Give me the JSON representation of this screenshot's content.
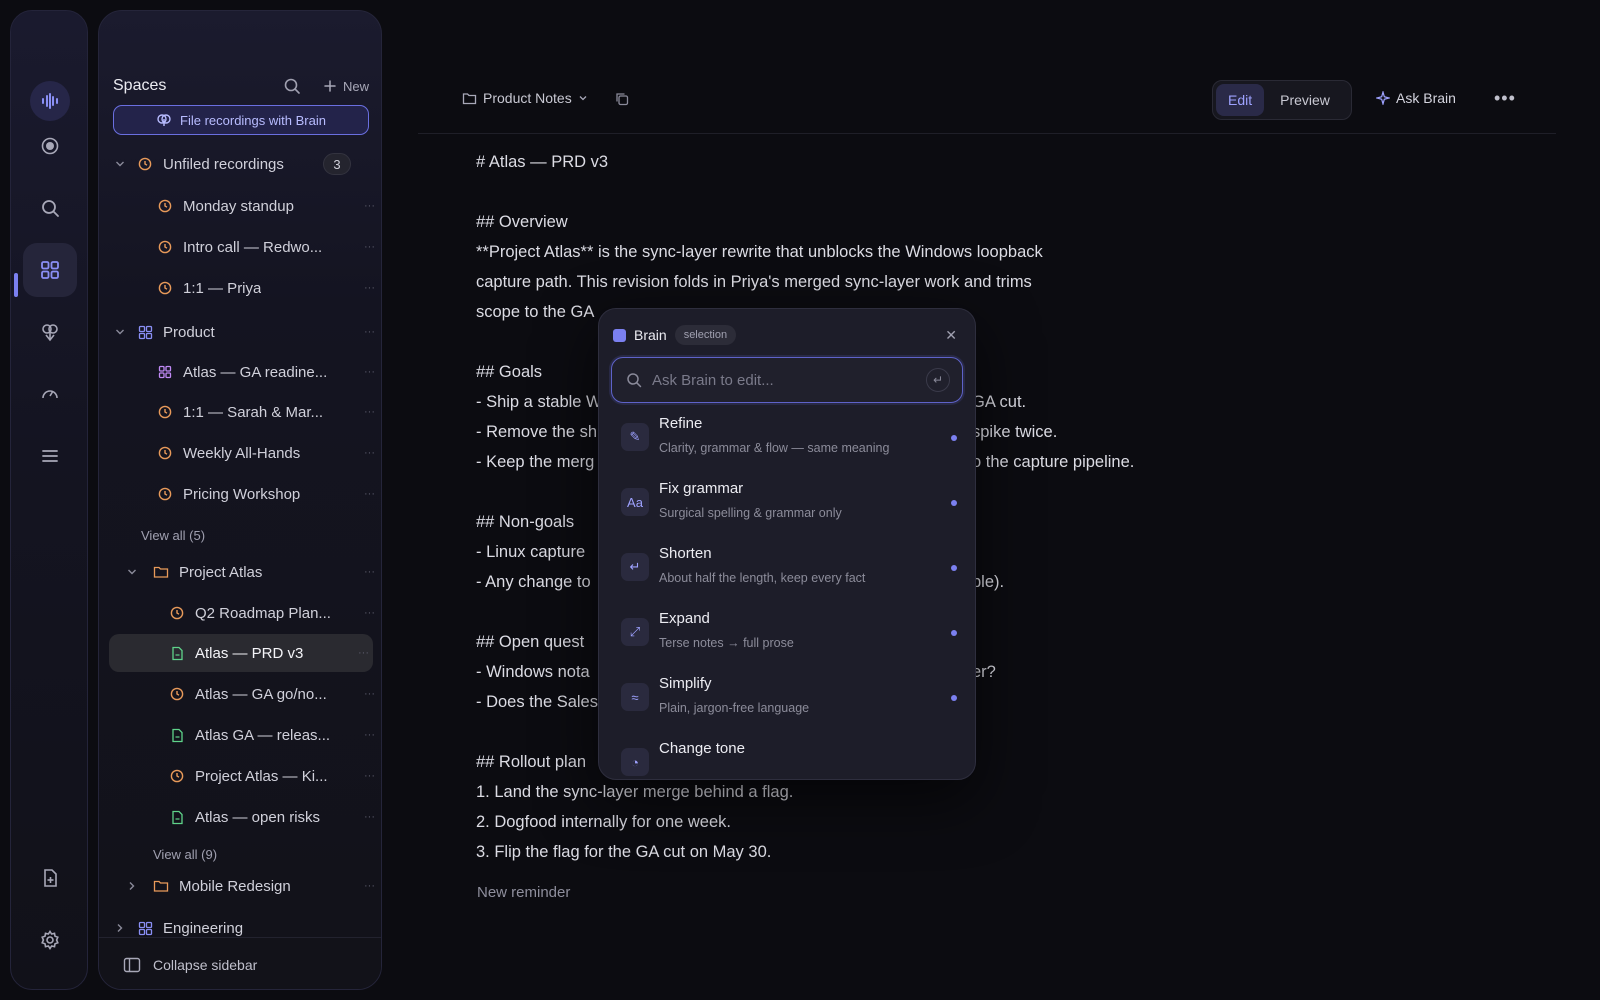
{
  "sidebar": {
    "title": "Spaces",
    "new_label": "New",
    "brain_button": "File recordings with Brain",
    "unfiled": {
      "label": "Unfiled recordings",
      "count": "3"
    },
    "unfiled_items": [
      "Monday standup",
      "Intro call — Redwo...",
      "1:1 — Priya"
    ],
    "product": {
      "label": "Product"
    },
    "product_items": [
      "Atlas — GA readine...",
      "1:1 — Sarah & Mar...",
      "Weekly All-Hands",
      "Pricing Workshop"
    ],
    "product_view_all": "View all (5)",
    "project_atlas": {
      "label": "Project Atlas"
    },
    "atlas_items": [
      "Q2 Roadmap Plan...",
      "Atlas — PRD v3",
      "Atlas — GA go/no...",
      "Atlas GA — releas...",
      "Project Atlas — Ki...",
      "Atlas — open risks"
    ],
    "atlas_view_all": "View all (9)",
    "mobile": {
      "label": "Mobile Redesign"
    },
    "engineering": {
      "label": "Engineering"
    },
    "collapse": "Collapse sidebar"
  },
  "topbar": {
    "breadcrumb": "Product Notes",
    "edit": "Edit",
    "preview": "Preview",
    "ask_brain": "Ask Brain"
  },
  "doc": {
    "lines": [
      "# Atlas — PRD v3",
      "## Overview",
      "**Project Atlas** is the sync-layer rewrite that unblocks the Windows loopback",
      "capture path. This revision folds in Priya's merged sync-layer work and trims",
      "scope to the GA",
      "## Goals",
      "- Ship a stable W",
      "- Remove the sh",
      "- Keep the merg",
      "## Non-goals",
      "- Linux capture",
      "- Any change to",
      "## Open quest",
      "- Windows nota",
      "- Does the Sales",
      "## Rollout plan",
      "1. Land the sync-layer merge behind a flag.",
      "2. Dogfood internally for one week.",
      "3. Flip the flag for the GA cut on May 30."
    ],
    "right_fragments": [
      "GA cut.",
      "spike twice.",
      "o the capture pipeline.",
      "ble).",
      "er?"
    ],
    "reminder": "New reminder"
  },
  "brain_popover": {
    "title": "Brain",
    "tag": "selection",
    "placeholder": "Ask Brain to edit...",
    "items": [
      {
        "title": "Refine",
        "desc": "Clarity, grammar & flow — same meaning",
        "icon": "✎"
      },
      {
        "title": "Fix grammar",
        "desc": "Surgical spelling & grammar only",
        "icon": "Aa"
      },
      {
        "title": "Shorten",
        "desc": "About half the length, keep every fact",
        "icon": "↵"
      },
      {
        "title": "Expand",
        "desc": "Terse notes → full prose",
        "icon": "⤢"
      },
      {
        "title": "Simplify",
        "desc": "Plain, jargon-free language",
        "icon": "≈"
      },
      {
        "title": "Change tone",
        "desc": "",
        "icon": "◔"
      }
    ]
  },
  "colors": {
    "accent": "#7b80f0",
    "recording_icon": "#e89a5a",
    "doc_icon": "#5fd38a",
    "space_icon": "#8a8ff5"
  }
}
